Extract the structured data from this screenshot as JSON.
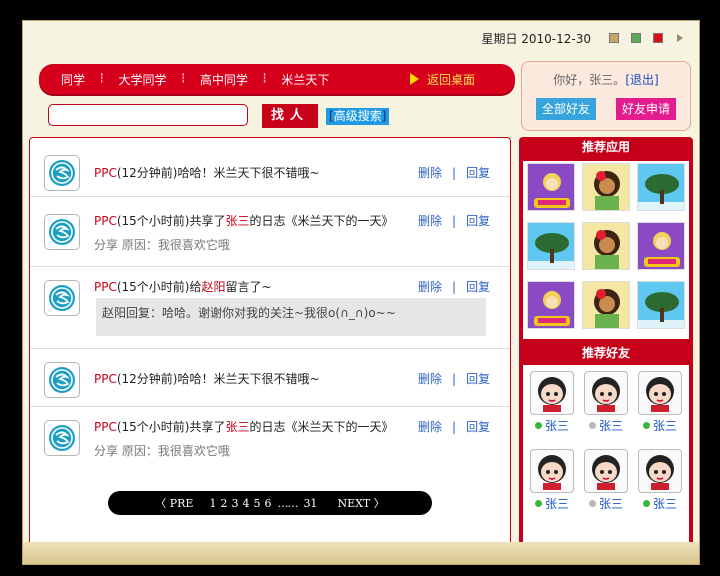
{
  "header": {
    "date": "星期日  2010-12-30",
    "theme_colors": [
      "#c9a46a",
      "#5da85a",
      "#d9101a"
    ]
  },
  "nav": {
    "items": [
      "同学",
      "大学同学",
      "高中同学",
      "米兰天下"
    ],
    "back_label": "返回桌面"
  },
  "user": {
    "greeting": "你好，张三。",
    "logout": "[退出]",
    "all_friends": "全部好友",
    "friend_request": "好友申请"
  },
  "search": {
    "value": "",
    "button": "找人",
    "advanced_open": "[",
    "advanced_label": "高级搜索",
    "advanced_close": "]"
  },
  "feed": {
    "items": [
      {
        "user": "PPC",
        "time": "(12分钟前)",
        "text": "哈哈！米兰天下很不错哦~"
      },
      {
        "user": "PPC",
        "time": "(15个小时前)",
        "pre": "共享了",
        "target": "张三",
        "post": "的日志《米兰天下的一天》",
        "sub": "分享  原因：我很喜欢它哦"
      },
      {
        "user": "PPC",
        "time": "(15个小时前)",
        "pre": "给",
        "target": "赵阳",
        "post": "留言了~",
        "reply": "赵阳回复：哈哈。谢谢你对我的关注~我很o(∩_∩)o~~"
      },
      {
        "user": "PPC",
        "time": "(12分钟前)",
        "text": "哈哈！米兰天下很不错哦~"
      },
      {
        "user": "PPC",
        "time": "(15个小时前)",
        "pre": "共享了",
        "target": "张三",
        "post": "的日志《米兰天下的一天》",
        "sub": "分享  原因：我很喜欢它哦"
      }
    ],
    "delete_label": "删除",
    "reply_label": "回复",
    "separator": "|"
  },
  "pager": {
    "prev": "PRE",
    "pages": [
      "1",
      "2",
      "3",
      "4",
      "5",
      "6"
    ],
    "dots": "……",
    "last": "31",
    "next": "NEXT"
  },
  "sidebar": {
    "apps_title": "推荐应用",
    "app_icons": [
      "game-icon",
      "character-icon",
      "tree-icon",
      "tree-icon",
      "character-icon",
      "game-icon",
      "game-icon",
      "character-icon",
      "tree-icon"
    ],
    "friends_title": "推荐好友",
    "friends": [
      {
        "name": "张三",
        "status": "online"
      },
      {
        "name": "张三",
        "status": "offline"
      },
      {
        "name": "张三",
        "status": "online"
      },
      {
        "name": "张三",
        "status": "online"
      },
      {
        "name": "张三",
        "status": "offline"
      },
      {
        "name": "张三",
        "status": "online"
      }
    ],
    "status_colors": {
      "online": "#3ab53a",
      "offline": "#b8b8b8"
    }
  }
}
